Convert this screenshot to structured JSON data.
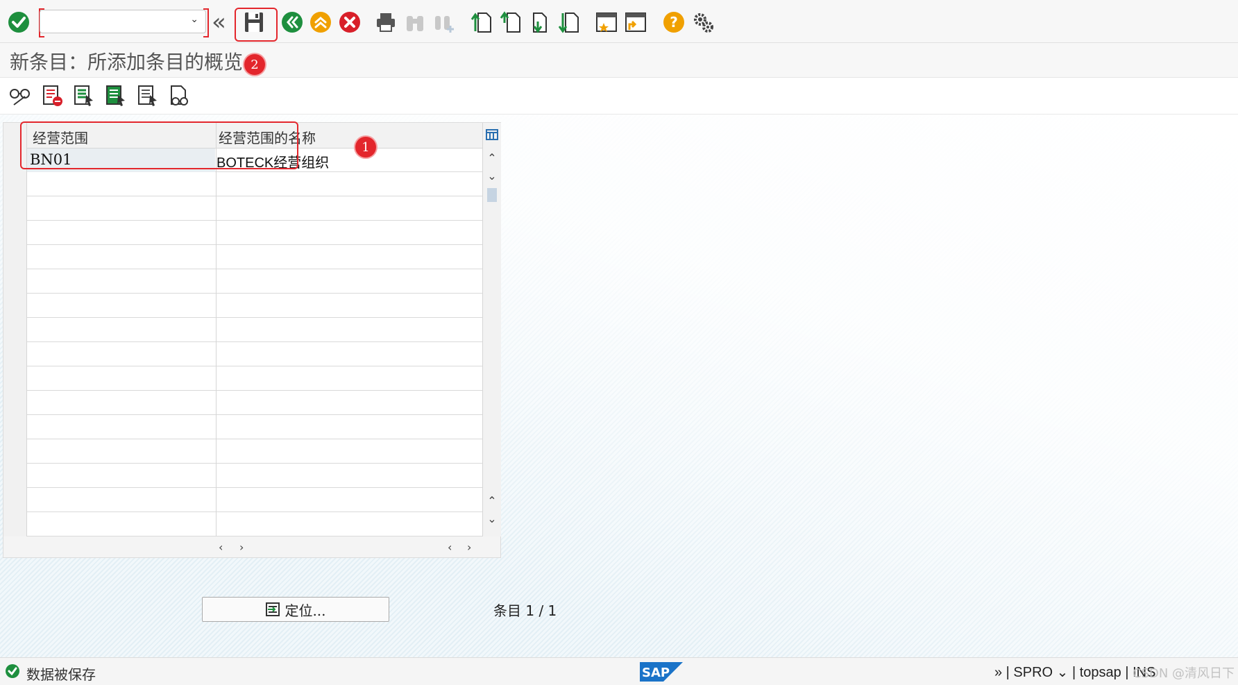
{
  "toolbar": {
    "command_field_value": "",
    "annotation_2": "2"
  },
  "title": "新条目：所添加条目的概览",
  "table": {
    "columns": [
      "经营范围",
      "经营范围的名称"
    ],
    "rows": [
      {
        "code": "BN01",
        "name": "BOTECK经营组织"
      }
    ],
    "annotation_1": "1"
  },
  "footer": {
    "locate_label": "定位...",
    "entry_label": "条目",
    "entry_count": "1 / 1"
  },
  "status": {
    "message": "数据被保存",
    "sysinfo": "»  |  SPRO ⌄  |  topsap  |  INS",
    "watermark": "CSDN @清风日下"
  },
  "colors": {
    "accent_red": "#e3262c",
    "success_green": "#1e8f3e",
    "warning_orange": "#f0a000",
    "sap_blue": "#1a73c8"
  }
}
